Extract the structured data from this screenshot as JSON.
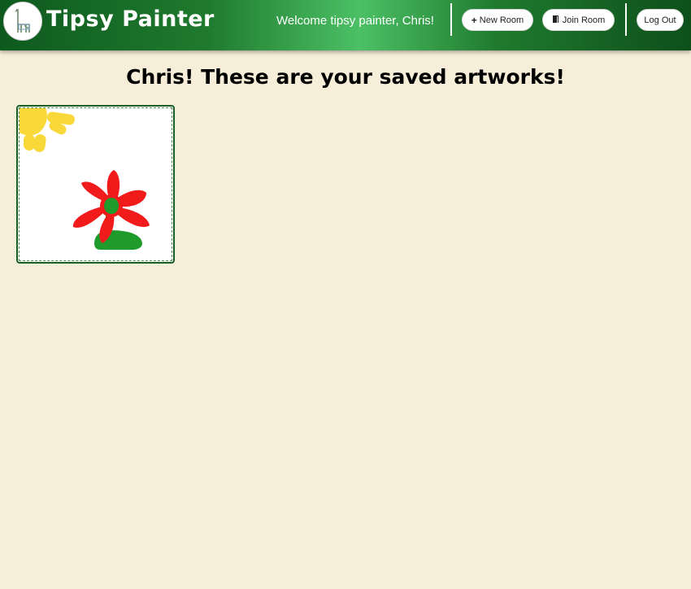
{
  "navbar": {
    "brand": "Tipsy Painter",
    "logo_icon": "giraffe-logo-icon",
    "welcome_text": "Welcome tipsy painter, Chris!",
    "new_room_label": "New Room",
    "new_room_icon": "plus-icon",
    "join_room_label": "Join Room",
    "join_room_icon": "door-icon",
    "logout_label": "Log Out",
    "colors": {
      "gradient_dark": "#0e5a1e",
      "gradient_light": "#4cc065",
      "text": "#ffffff"
    }
  },
  "main": {
    "heading": "Chris! These are your saved artworks!",
    "background": "#f7eed9",
    "artworks": [
      {
        "subject": "flower-with-sun-drawing",
        "colors": {
          "sun": "#f9d83a",
          "petals": "#f21b1b",
          "center": "#1f9b2b",
          "stem": "#1f9b2b"
        }
      }
    ]
  }
}
